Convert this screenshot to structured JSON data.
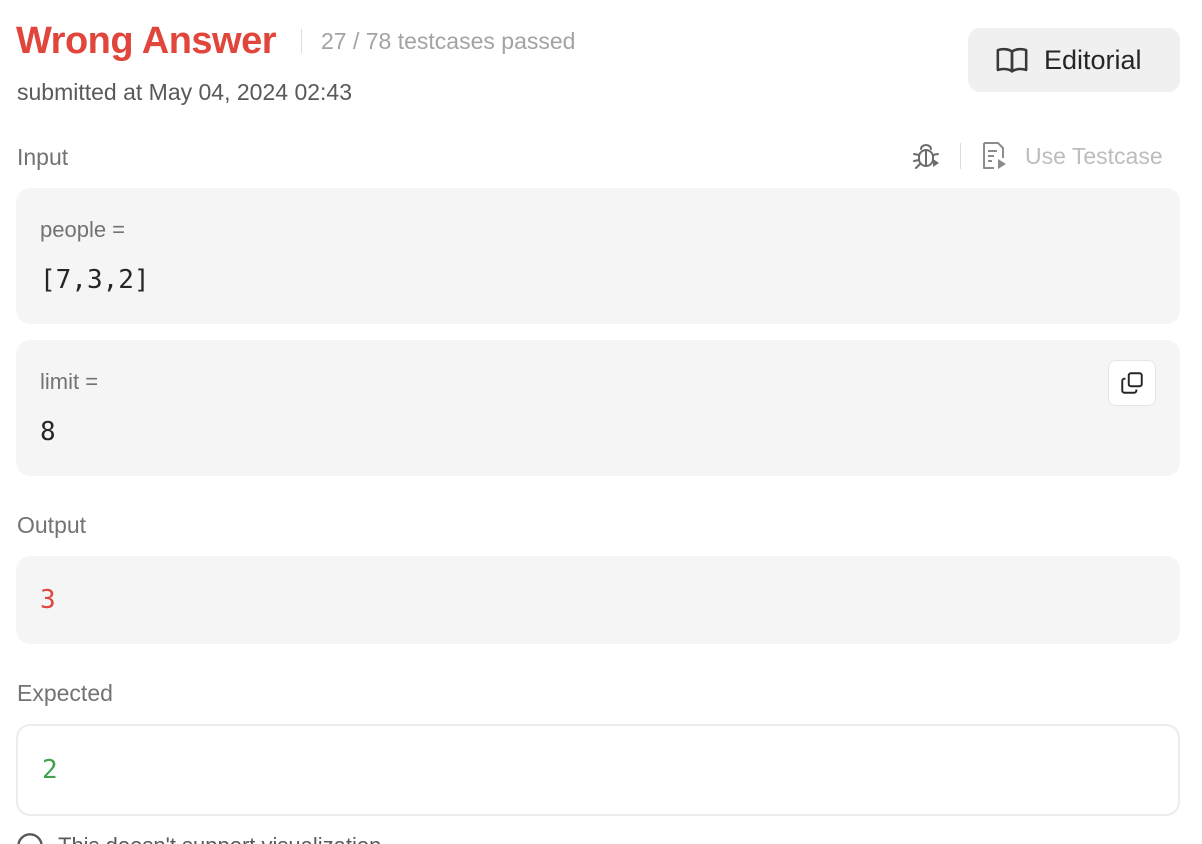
{
  "result": {
    "verdict": "Wrong Answer",
    "verdict_color": "#e0463b",
    "testcases_passed": "27 / 78 testcases passed",
    "submitted": "submitted at May 04, 2024 02:43"
  },
  "editorial": {
    "label": "Editorial",
    "icon": "book-open-icon"
  },
  "input": {
    "label": "Input",
    "debug_icon": "bug-icon",
    "use_testcase_label": "Use Testcase",
    "use_testcase_icon": "file-play-icon",
    "params": [
      {
        "name": "people =",
        "value": "[7,3,2]"
      },
      {
        "name": "limit =",
        "value": "8"
      }
    ],
    "copy_icon": "copy-icon"
  },
  "output": {
    "label": "Output",
    "value": "3",
    "color": "#e0463b"
  },
  "expected": {
    "label": "Expected",
    "value": "2",
    "color": "#3fa34d"
  },
  "footer": {
    "text": "This doesn't support visualization",
    "icon": "info-circle-icon"
  }
}
